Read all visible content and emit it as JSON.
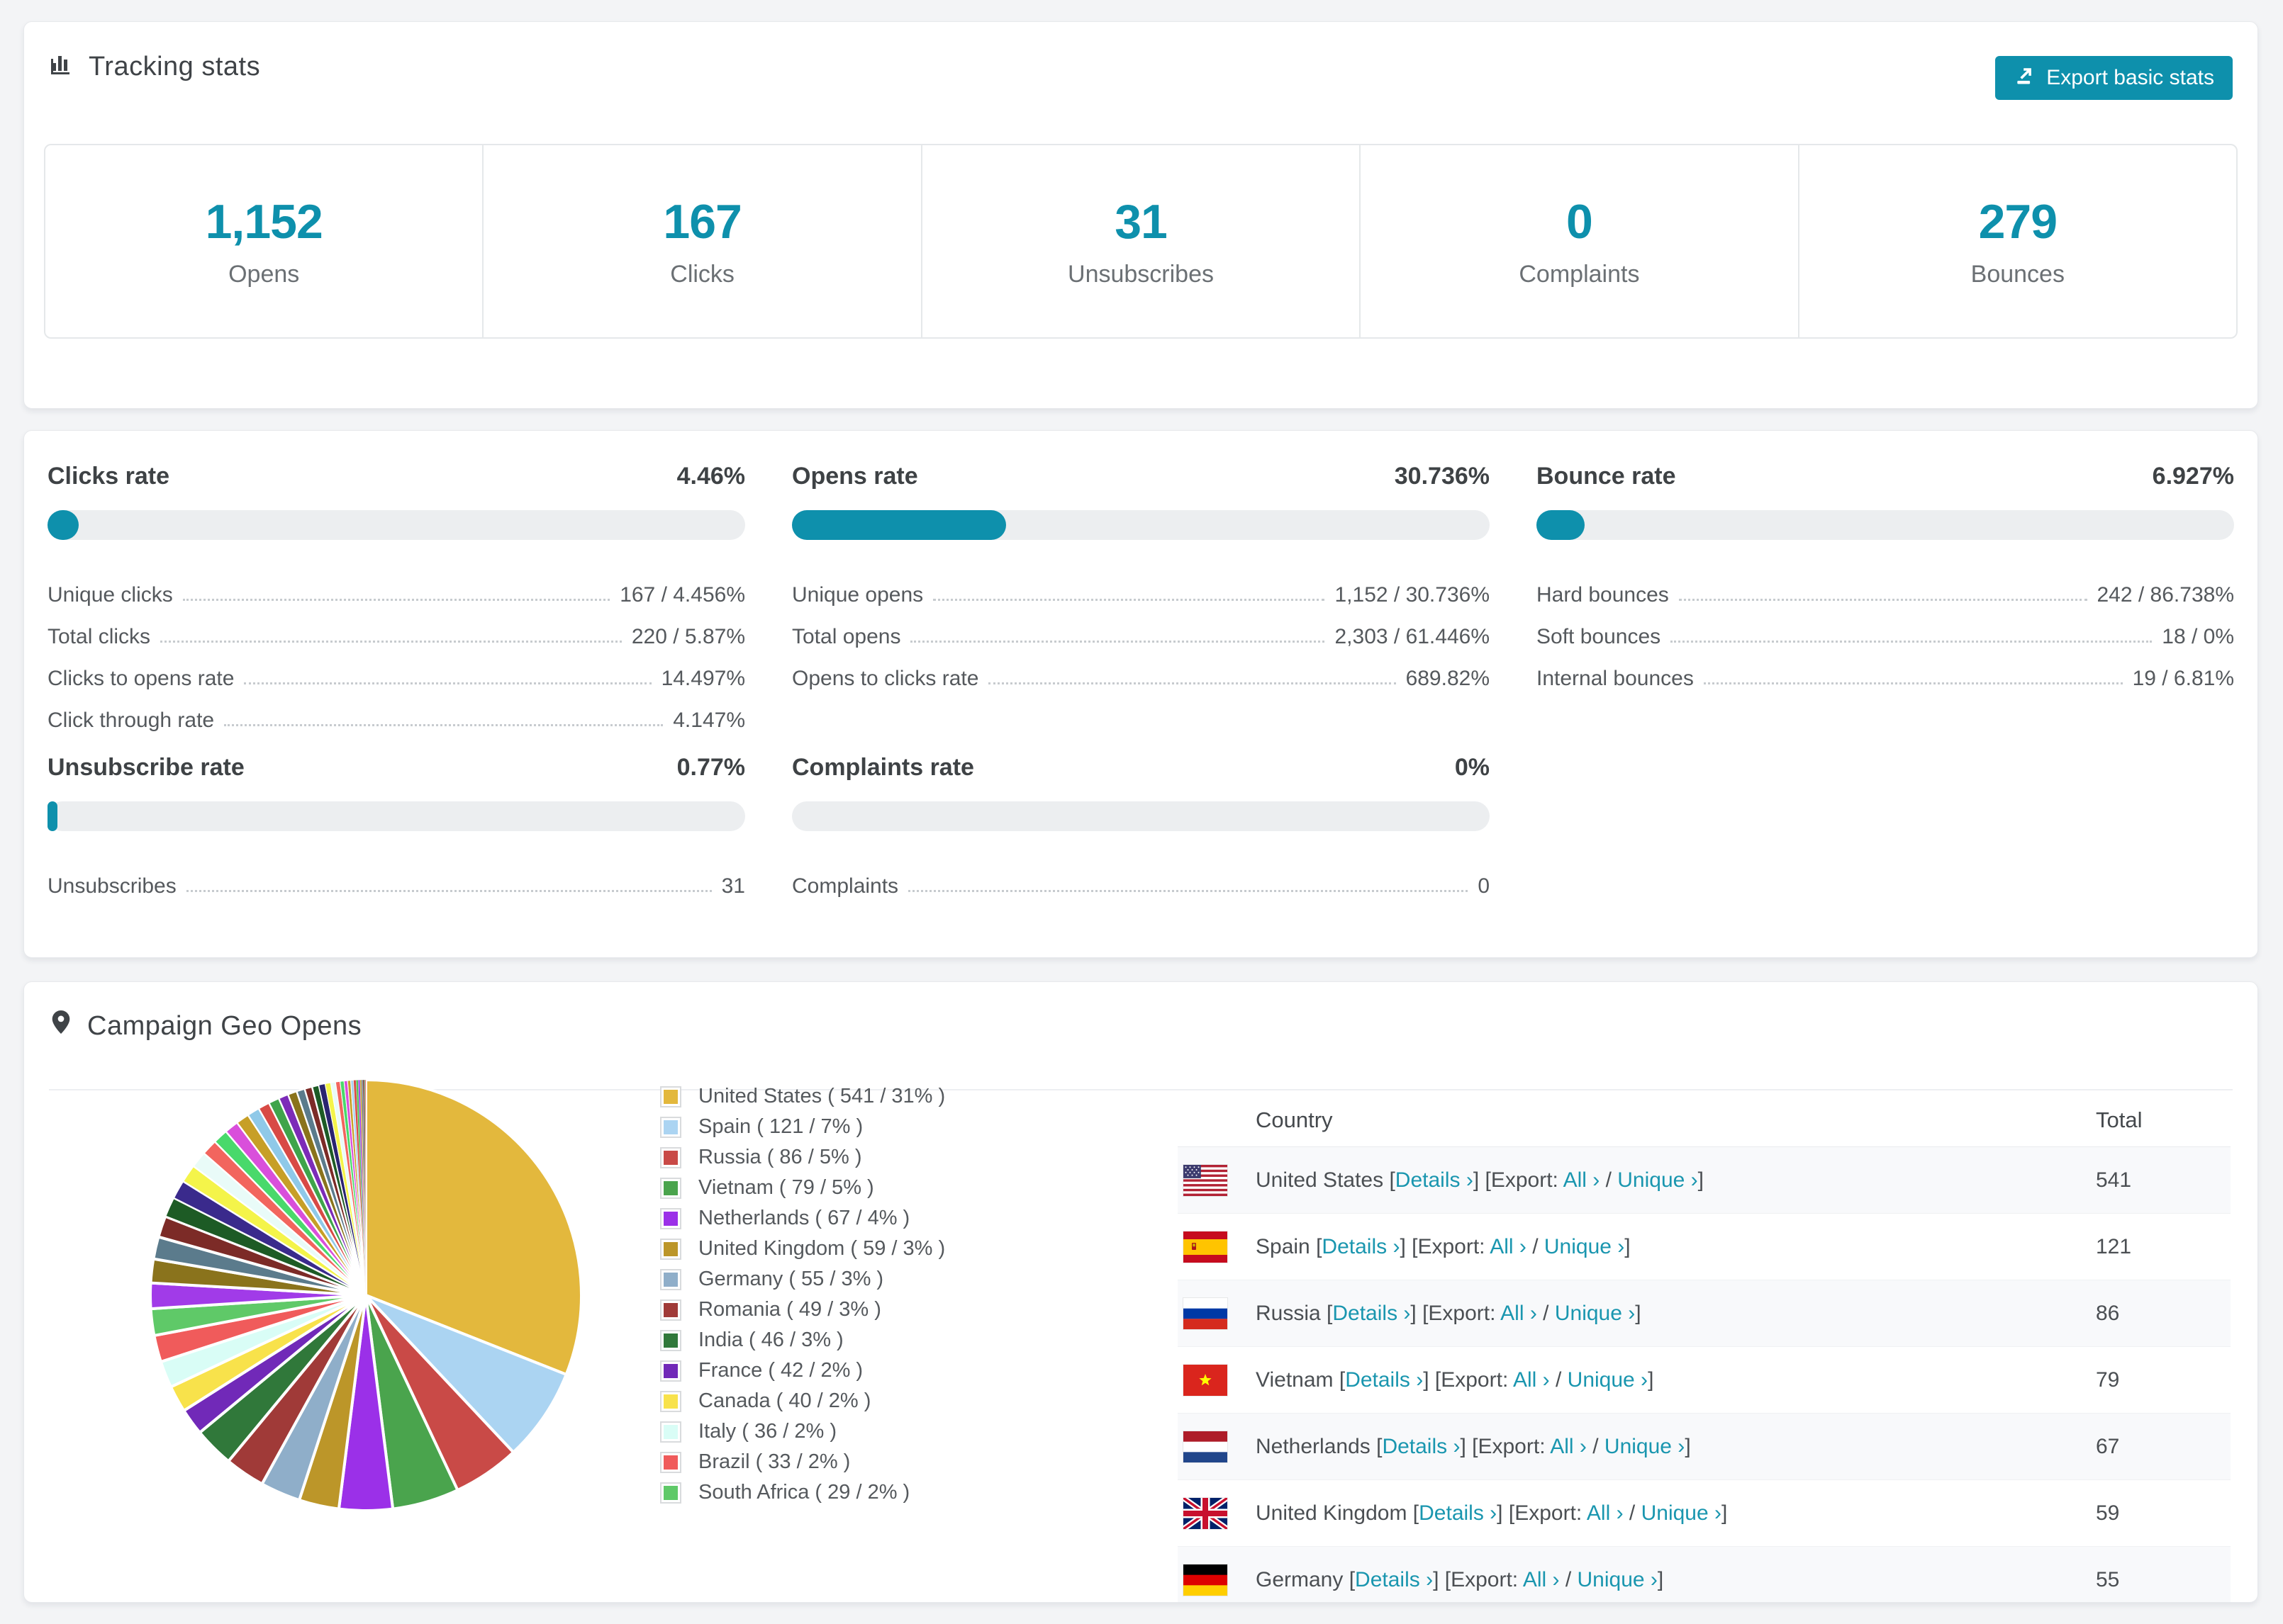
{
  "colors": {
    "accent": "#0e90ac",
    "link": "#1a96af",
    "bar_track": "#eceef0",
    "stripe": "#f8f9fb"
  },
  "tracking": {
    "title": "Tracking stats",
    "export_label": "Export basic stats",
    "stats": [
      {
        "value": "1,152",
        "label": "Opens"
      },
      {
        "value": "167",
        "label": "Clicks"
      },
      {
        "value": "31",
        "label": "Unsubscribes"
      },
      {
        "value": "0",
        "label": "Complaints"
      },
      {
        "value": "279",
        "label": "Bounces"
      }
    ]
  },
  "rates": [
    {
      "title": "Clicks rate",
      "value": "4.46%",
      "pct": 4.46,
      "rows": [
        {
          "label": "Unique clicks",
          "value": "167 / 4.456%"
        },
        {
          "label": "Total clicks",
          "value": "220 / 5.87%"
        },
        {
          "label": "Clicks to opens rate",
          "value": "14.497%"
        },
        {
          "label": "Click through rate",
          "value": "4.147%"
        }
      ]
    },
    {
      "title": "Opens rate",
      "value": "30.736%",
      "pct": 30.736,
      "rows": [
        {
          "label": "Unique opens",
          "value": "1,152 / 30.736%"
        },
        {
          "label": "Total opens",
          "value": "2,303 / 61.446%"
        },
        {
          "label": "Opens to clicks rate",
          "value": "689.82%"
        }
      ]
    },
    {
      "title": "Bounce rate",
      "value": "6.927%",
      "pct": 6.927,
      "rows": [
        {
          "label": "Hard bounces",
          "value": "242 / 86.738%"
        },
        {
          "label": "Soft bounces",
          "value": "18 / 0%"
        },
        {
          "label": "Internal bounces",
          "value": "19 / 6.81%"
        }
      ]
    },
    {
      "title": "Unsubscribe rate",
      "value": "0.77%",
      "pct": 0.77,
      "rows": [
        {
          "label": "Unsubscribes",
          "value": "31"
        }
      ]
    },
    {
      "title": "Complaints rate",
      "value": "0%",
      "pct": 0,
      "rows": [
        {
          "label": "Complaints",
          "value": "0"
        }
      ]
    }
  ],
  "geo": {
    "title": "Campaign Geo Opens",
    "table": {
      "headers": {
        "country": "Country",
        "total": "Total"
      },
      "link_details": "Details ›",
      "export_prefix": "Export:",
      "link_all": "All ›",
      "link_unique": "Unique ›",
      "rows": [
        {
          "flag": "us",
          "country": "United States",
          "total": "541"
        },
        {
          "flag": "es",
          "country": "Spain",
          "total": "121"
        },
        {
          "flag": "ru",
          "country": "Russia",
          "total": "86"
        },
        {
          "flag": "vn",
          "country": "Vietnam",
          "total": "79"
        },
        {
          "flag": "nl",
          "country": "Netherlands",
          "total": "67"
        },
        {
          "flag": "gb",
          "country": "United Kingdom",
          "total": "59"
        },
        {
          "flag": "de",
          "country": "Germany",
          "total": "55"
        }
      ]
    }
  },
  "chart_data": {
    "type": "pie",
    "title": "Campaign Geo Opens",
    "start_angle_deg": 0,
    "direction": "clockwise",
    "legend_position": "right",
    "slices": [
      {
        "name": "United States",
        "count": 541,
        "pct": 31,
        "color": "#E3B83D",
        "label": "United States ( 541 / 31% )"
      },
      {
        "name": "Spain",
        "count": 121,
        "pct": 7,
        "color": "#ABD4F2",
        "label": "Spain ( 121 / 7% )"
      },
      {
        "name": "Russia",
        "count": 86,
        "pct": 5,
        "color": "#C94A47",
        "label": "Russia ( 86 / 5% )"
      },
      {
        "name": "Vietnam",
        "count": 79,
        "pct": 5,
        "color": "#4AA44D",
        "label": "Vietnam ( 79 / 5% )"
      },
      {
        "name": "Netherlands",
        "count": 67,
        "pct": 4,
        "color": "#9B30E8",
        "label": "Netherlands ( 67 / 4% )"
      },
      {
        "name": "United Kingdom",
        "count": 59,
        "pct": 3,
        "color": "#BC9629",
        "label": "United Kingdom ( 59 / 3% )"
      },
      {
        "name": "Germany",
        "count": 55,
        "pct": 3,
        "color": "#8FAEC9",
        "label": "Germany ( 55 / 3% )"
      },
      {
        "name": "Romania",
        "count": 49,
        "pct": 3,
        "color": "#A03A38",
        "label": "Romania ( 49 / 3% )"
      },
      {
        "name": "India",
        "count": 46,
        "pct": 3,
        "color": "#30783A",
        "label": "India ( 46 / 3% )"
      },
      {
        "name": "France",
        "count": 42,
        "pct": 2,
        "color": "#7129B8",
        "label": "France ( 42 / 2% )"
      },
      {
        "name": "Canada",
        "count": 40,
        "pct": 2,
        "color": "#F8E24B",
        "label": "Canada ( 40 / 2% )"
      },
      {
        "name": "Italy",
        "count": 36,
        "pct": 2,
        "color": "#D9FDF6",
        "label": "Italy ( 36 / 2% )"
      },
      {
        "name": "Brazil",
        "count": 33,
        "pct": 2,
        "color": "#F05B5B",
        "label": "Brazil ( 33 / 2% )"
      },
      {
        "name": "South Africa",
        "count": 29,
        "pct": 2,
        "color": "#5FC968",
        "label": "South Africa ( 29 / 2% )"
      }
    ],
    "others_pct_total": 26,
    "others": [
      {
        "color": "#A13BE8",
        "v": 1.55
      },
      {
        "color": "#8A731C",
        "v": 1.45
      },
      {
        "color": "#5B7B8C",
        "v": 1.35
      },
      {
        "color": "#7C2B27",
        "v": 1.3
      },
      {
        "color": "#1D5B25",
        "v": 1.2
      },
      {
        "color": "#3A2A8C",
        "v": 1.15
      },
      {
        "color": "#F4F44A",
        "v": 1.1
      },
      {
        "color": "#E9FBF8",
        "v": 1.0
      },
      {
        "color": "#F2655E",
        "v": 0.95
      },
      {
        "color": "#49D96B",
        "v": 0.9
      },
      {
        "color": "#D94FDB",
        "v": 0.85
      },
      {
        "color": "#C79F27",
        "v": 0.8
      },
      {
        "color": "#8FC9E8",
        "v": 0.75
      },
      {
        "color": "#D84A45",
        "v": 0.7
      },
      {
        "color": "#3FA44A",
        "v": 0.65
      },
      {
        "color": "#7C2BB8",
        "v": 0.6
      },
      {
        "color": "#8A731C",
        "v": 0.55
      },
      {
        "color": "#5B7B8C",
        "v": 0.5
      },
      {
        "color": "#7C2B27",
        "v": 0.46
      },
      {
        "color": "#1D5B25",
        "v": 0.42
      },
      {
        "color": "#2A2470",
        "v": 0.38
      },
      {
        "color": "#F4F44A",
        "v": 0.34
      },
      {
        "color": "#E9FBF8",
        "v": 0.3
      },
      {
        "color": "#F2655E",
        "v": 0.27
      },
      {
        "color": "#49D96B",
        "v": 0.24
      },
      {
        "color": "#D94FDB",
        "v": 0.21
      },
      {
        "color": "#C79F27",
        "v": 0.19
      },
      {
        "color": "#A6D2F0",
        "v": 0.17
      },
      {
        "color": "#D84A45",
        "v": 0.15
      },
      {
        "color": "#52C15A",
        "v": 0.13
      },
      {
        "color": "#A13BE8",
        "v": 0.11
      },
      {
        "color": "#C79F27",
        "v": 0.09
      },
      {
        "color": "#5B7B8C",
        "v": 0.08
      },
      {
        "color": "#7C2B27",
        "v": 0.07
      },
      {
        "color": "#1D5B25",
        "v": 0.06
      },
      {
        "color": "#F2655E",
        "v": 0.05
      }
    ]
  }
}
